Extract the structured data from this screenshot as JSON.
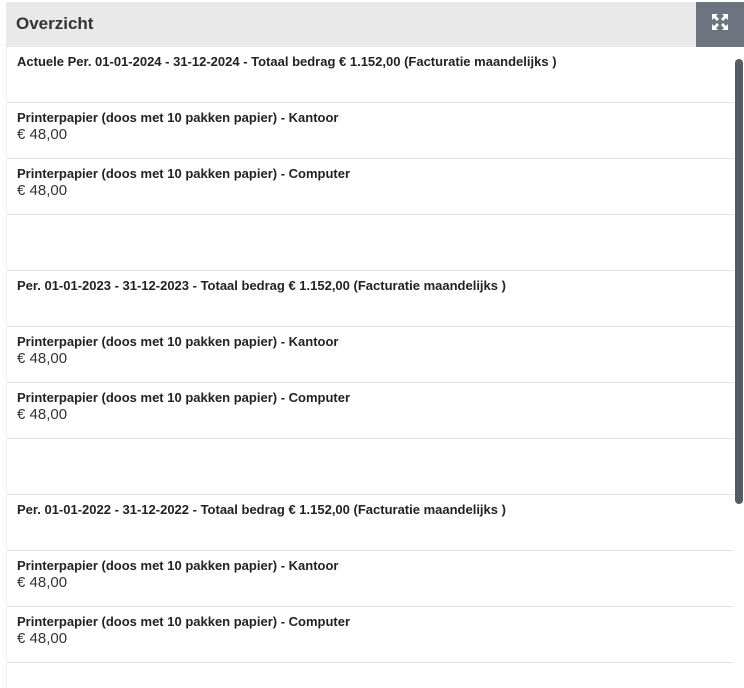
{
  "header": {
    "title": "Overzicht",
    "expand_icon": "expand-arrows-icon"
  },
  "rows": [
    {
      "title": "Actuele Per. 01-01-2024 - 31-12-2024 - Totaal bedrag € 1.152,00 (Facturatie maandelijks )",
      "amount": ""
    },
    {
      "title": "Printerpapier (doos met 10 pakken papier) - Kantoor",
      "amount": "€ 48,00"
    },
    {
      "title": "Printerpapier (doos met 10 pakken papier) - Computer",
      "amount": "€ 48,00"
    },
    {
      "title": "",
      "amount": ""
    },
    {
      "title": "Per. 01-01-2023 - 31-12-2023 - Totaal bedrag € 1.152,00 (Facturatie maandelijks )",
      "amount": ""
    },
    {
      "title": "Printerpapier (doos met 10 pakken papier) - Kantoor",
      "amount": "€ 48,00"
    },
    {
      "title": "Printerpapier (doos met 10 pakken papier) - Computer",
      "amount": "€ 48,00"
    },
    {
      "title": "",
      "amount": ""
    },
    {
      "title": "Per. 01-01-2022 - 31-12-2022 - Totaal bedrag € 1.152,00 (Facturatie maandelijks )",
      "amount": ""
    },
    {
      "title": "Printerpapier (doos met 10 pakken papier) - Kantoor",
      "amount": "€ 48,00"
    },
    {
      "title": "Printerpapier (doos met 10 pakken papier) - Computer",
      "amount": "€ 48,00"
    },
    {
      "title": "",
      "amount": ""
    }
  ],
  "colors": {
    "header_bg": "#e9e9e9",
    "button_bg": "#6d7480",
    "scrollbar_thumb": "#555c66"
  }
}
